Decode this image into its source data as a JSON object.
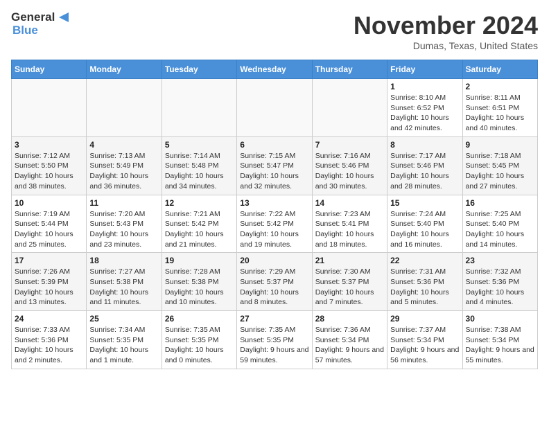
{
  "header": {
    "logo_line1": "General",
    "logo_line2": "Blue",
    "month_title": "November 2024",
    "location": "Dumas, Texas, United States"
  },
  "weekdays": [
    "Sunday",
    "Monday",
    "Tuesday",
    "Wednesday",
    "Thursday",
    "Friday",
    "Saturday"
  ],
  "weeks": [
    [
      {
        "day": "",
        "info": ""
      },
      {
        "day": "",
        "info": ""
      },
      {
        "day": "",
        "info": ""
      },
      {
        "day": "",
        "info": ""
      },
      {
        "day": "",
        "info": ""
      },
      {
        "day": "1",
        "info": "Sunrise: 8:10 AM\nSunset: 6:52 PM\nDaylight: 10 hours and 42 minutes."
      },
      {
        "day": "2",
        "info": "Sunrise: 8:11 AM\nSunset: 6:51 PM\nDaylight: 10 hours and 40 minutes."
      }
    ],
    [
      {
        "day": "3",
        "info": "Sunrise: 7:12 AM\nSunset: 5:50 PM\nDaylight: 10 hours and 38 minutes."
      },
      {
        "day": "4",
        "info": "Sunrise: 7:13 AM\nSunset: 5:49 PM\nDaylight: 10 hours and 36 minutes."
      },
      {
        "day": "5",
        "info": "Sunrise: 7:14 AM\nSunset: 5:48 PM\nDaylight: 10 hours and 34 minutes."
      },
      {
        "day": "6",
        "info": "Sunrise: 7:15 AM\nSunset: 5:47 PM\nDaylight: 10 hours and 32 minutes."
      },
      {
        "day": "7",
        "info": "Sunrise: 7:16 AM\nSunset: 5:46 PM\nDaylight: 10 hours and 30 minutes."
      },
      {
        "day": "8",
        "info": "Sunrise: 7:17 AM\nSunset: 5:46 PM\nDaylight: 10 hours and 28 minutes."
      },
      {
        "day": "9",
        "info": "Sunrise: 7:18 AM\nSunset: 5:45 PM\nDaylight: 10 hours and 27 minutes."
      }
    ],
    [
      {
        "day": "10",
        "info": "Sunrise: 7:19 AM\nSunset: 5:44 PM\nDaylight: 10 hours and 25 minutes."
      },
      {
        "day": "11",
        "info": "Sunrise: 7:20 AM\nSunset: 5:43 PM\nDaylight: 10 hours and 23 minutes."
      },
      {
        "day": "12",
        "info": "Sunrise: 7:21 AM\nSunset: 5:42 PM\nDaylight: 10 hours and 21 minutes."
      },
      {
        "day": "13",
        "info": "Sunrise: 7:22 AM\nSunset: 5:42 PM\nDaylight: 10 hours and 19 minutes."
      },
      {
        "day": "14",
        "info": "Sunrise: 7:23 AM\nSunset: 5:41 PM\nDaylight: 10 hours and 18 minutes."
      },
      {
        "day": "15",
        "info": "Sunrise: 7:24 AM\nSunset: 5:40 PM\nDaylight: 10 hours and 16 minutes."
      },
      {
        "day": "16",
        "info": "Sunrise: 7:25 AM\nSunset: 5:40 PM\nDaylight: 10 hours and 14 minutes."
      }
    ],
    [
      {
        "day": "17",
        "info": "Sunrise: 7:26 AM\nSunset: 5:39 PM\nDaylight: 10 hours and 13 minutes."
      },
      {
        "day": "18",
        "info": "Sunrise: 7:27 AM\nSunset: 5:38 PM\nDaylight: 10 hours and 11 minutes."
      },
      {
        "day": "19",
        "info": "Sunrise: 7:28 AM\nSunset: 5:38 PM\nDaylight: 10 hours and 10 minutes."
      },
      {
        "day": "20",
        "info": "Sunrise: 7:29 AM\nSunset: 5:37 PM\nDaylight: 10 hours and 8 minutes."
      },
      {
        "day": "21",
        "info": "Sunrise: 7:30 AM\nSunset: 5:37 PM\nDaylight: 10 hours and 7 minutes."
      },
      {
        "day": "22",
        "info": "Sunrise: 7:31 AM\nSunset: 5:36 PM\nDaylight: 10 hours and 5 minutes."
      },
      {
        "day": "23",
        "info": "Sunrise: 7:32 AM\nSunset: 5:36 PM\nDaylight: 10 hours and 4 minutes."
      }
    ],
    [
      {
        "day": "24",
        "info": "Sunrise: 7:33 AM\nSunset: 5:36 PM\nDaylight: 10 hours and 2 minutes."
      },
      {
        "day": "25",
        "info": "Sunrise: 7:34 AM\nSunset: 5:35 PM\nDaylight: 10 hours and 1 minute."
      },
      {
        "day": "26",
        "info": "Sunrise: 7:35 AM\nSunset: 5:35 PM\nDaylight: 10 hours and 0 minutes."
      },
      {
        "day": "27",
        "info": "Sunrise: 7:35 AM\nSunset: 5:35 PM\nDaylight: 9 hours and 59 minutes."
      },
      {
        "day": "28",
        "info": "Sunrise: 7:36 AM\nSunset: 5:34 PM\nDaylight: 9 hours and 57 minutes."
      },
      {
        "day": "29",
        "info": "Sunrise: 7:37 AM\nSunset: 5:34 PM\nDaylight: 9 hours and 56 minutes."
      },
      {
        "day": "30",
        "info": "Sunrise: 7:38 AM\nSunset: 5:34 PM\nDaylight: 9 hours and 55 minutes."
      }
    ]
  ]
}
